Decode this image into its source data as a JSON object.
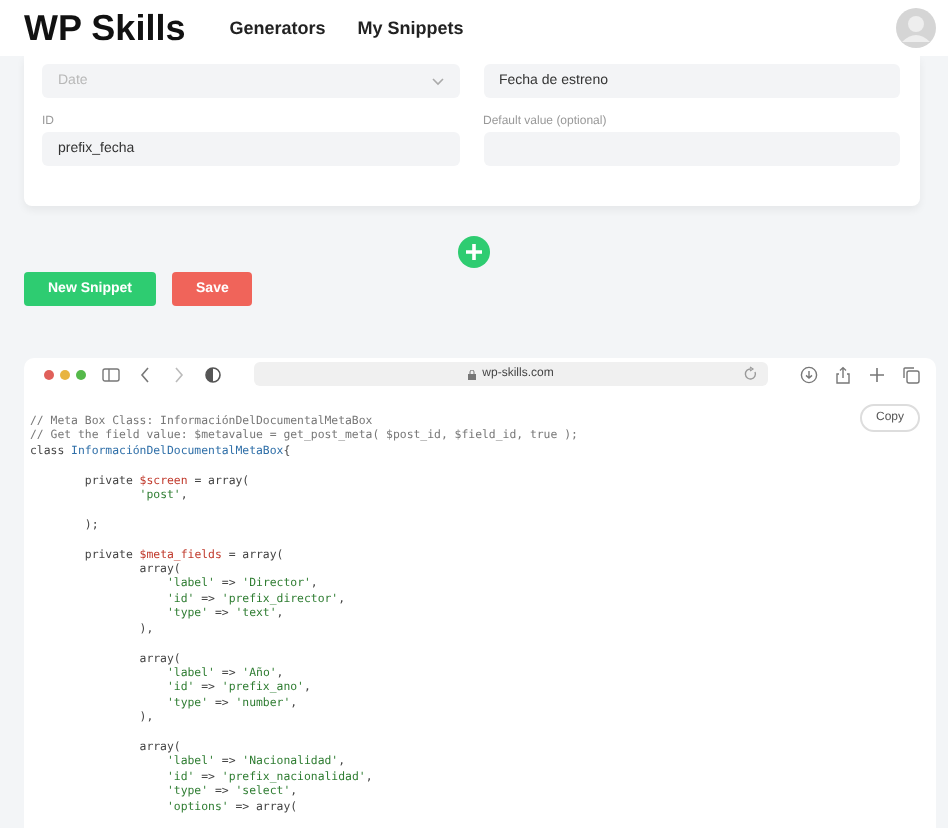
{
  "header": {
    "logo": "WP Skills",
    "nav": [
      {
        "label": "Generators"
      },
      {
        "label": "My Snippets"
      }
    ]
  },
  "form": {
    "fields": [
      {
        "kind": "select",
        "placeholder": "Date",
        "disabled": true
      },
      {
        "kind": "text",
        "value": "Fecha de estreno"
      },
      {
        "kind": "text",
        "label": "ID",
        "value": "prefix_fecha"
      },
      {
        "kind": "text",
        "label": "Default value (optional)"
      }
    ]
  },
  "buttons": [
    {
      "label": "New Snippet",
      "kind": "primary"
    },
    {
      "label": "Save",
      "kind": "danger"
    }
  ],
  "browser": {
    "url": "wp-skills.com"
  },
  "code": {
    "copy_label": "Copy",
    "text": "// Meta Box Class: InformaciónDelDocumentalMetaBox\n// Get the field value: $metavalue = get_post_meta( $post_id, $field_id, true );\nclass InformaciónDelDocumentalMetaBox{\n\n        private $screen = array(\n                'post',\n\n        );\n\n        private $meta_fields = array(\n                array(\n                    'label' => 'Director',\n                    'id' => 'prefix_director',\n                    'type' => 'text',\n                ),\n\n                array(\n                    'label' => 'Año',\n                    'id' => 'prefix_ano',\n                    'type' => 'number',\n                ),\n\n                array(\n                    'label' => 'Nacionalidad',\n                    'id' => 'prefix_nacionalidad',\n                    'type' => 'select',\n                    'options' => array("
  }
}
